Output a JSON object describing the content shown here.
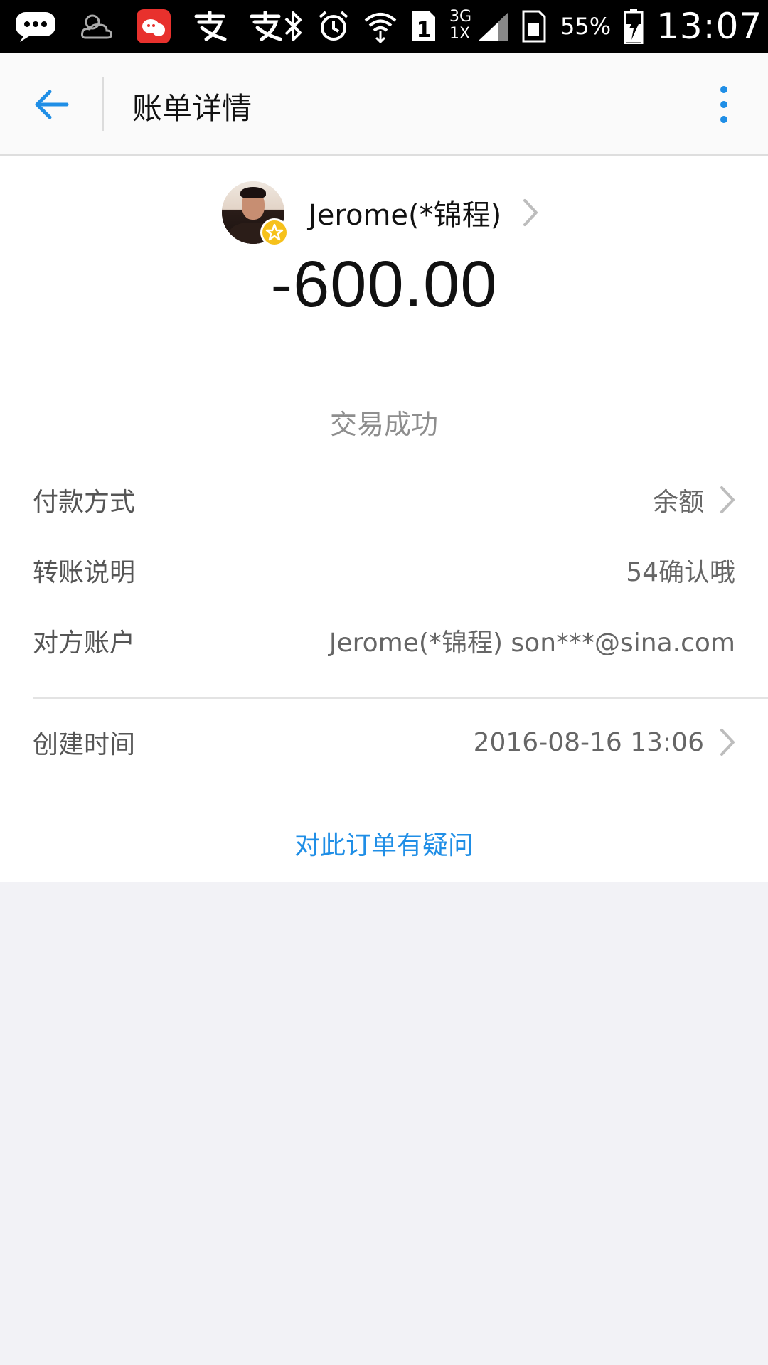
{
  "status_bar": {
    "carrier_icons": [
      "chat-icon",
      "cloudy-icon",
      "weibo-icon",
      "alipay-icon",
      "alipay-icon"
    ],
    "right_icons": [
      "bluetooth-icon",
      "alarm-icon",
      "wifi-icon",
      "sim1-icon",
      "signal-icon",
      "sim-card-icon",
      "battery-icon"
    ],
    "sim_slot": "1",
    "network_top": "3G",
    "network_bottom": "1X",
    "battery": "55%",
    "time": "13:07"
  },
  "app_bar": {
    "title": "账单详情"
  },
  "payee": {
    "name": "Jerome(*锦程)"
  },
  "transaction": {
    "amount": "-600.00",
    "status": "交易成功"
  },
  "details": [
    {
      "label": "付款方式",
      "value": "余额",
      "has_chevron": true
    },
    {
      "label": "转账说明",
      "value": "54确认哦",
      "has_chevron": false
    },
    {
      "label": "对方账户",
      "value": "Jerome(*锦程) son***@sina.com",
      "has_chevron": false
    },
    {
      "label": "创建时间",
      "value": "2016-08-16 13:06",
      "has_chevron": true
    }
  ],
  "footer_link": "对此订单有疑问",
  "colors": {
    "accent": "#1f8ee6",
    "background": "#f2f2f6",
    "badge": "#f6c11b"
  }
}
